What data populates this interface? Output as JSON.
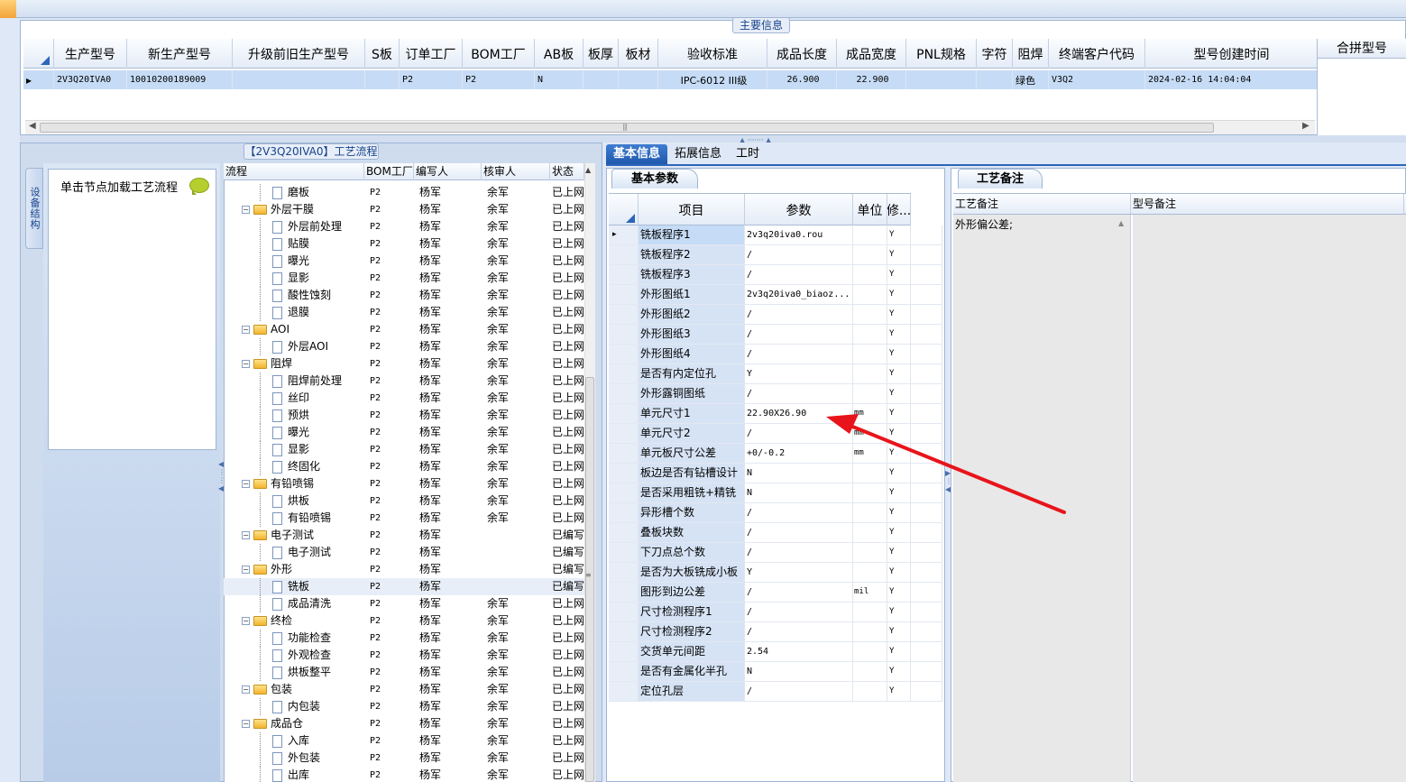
{
  "main_info": {
    "title": "主要信息",
    "columns": [
      "生产型号",
      "新生产型号",
      "升级前旧生产型号",
      "S板",
      "订单工厂",
      "BOM工厂",
      "AB板",
      "板厚",
      "板材",
      "验收标准",
      "成品长度",
      "成品宽度",
      "PNL规格",
      "字符",
      "阻焊",
      "终端客户代码",
      "型号创建时间"
    ],
    "row": [
      "2V3Q20IVA0",
      "10010200189009",
      "",
      "",
      "P2",
      "P2",
      "N",
      "",
      "",
      "IPC-6012 III级",
      "26.900",
      "22.900",
      "",
      "",
      "绿色",
      "V3Q2",
      "2024-02-16 14:04:04"
    ],
    "merge_column": "合拼型号"
  },
  "process_flow": {
    "title": "【2V3Q20IVA0】工艺流程",
    "side_tab": "设备结构",
    "nav_hint": "单击节点加载工艺流程",
    "columns": [
      "流程",
      "BOM工厂",
      "编写人",
      "核审人",
      "状态"
    ],
    "rows": [
      {
        "level": 2,
        "type": "doc",
        "name": "磨板",
        "bom": "P2",
        "writer": "杨军",
        "reviewer": "余军",
        "status": "已上网"
      },
      {
        "level": 1,
        "type": "folder",
        "name": "外层干膜",
        "bom": "P2",
        "writer": "杨军",
        "reviewer": "余军",
        "status": "已上网"
      },
      {
        "level": 2,
        "type": "doc",
        "name": "外层前处理",
        "bom": "P2",
        "writer": "杨军",
        "reviewer": "余军",
        "status": "已上网"
      },
      {
        "level": 2,
        "type": "doc",
        "name": "贴膜",
        "bom": "P2",
        "writer": "杨军",
        "reviewer": "余军",
        "status": "已上网"
      },
      {
        "level": 2,
        "type": "doc",
        "name": "曝光",
        "bom": "P2",
        "writer": "杨军",
        "reviewer": "余军",
        "status": "已上网"
      },
      {
        "level": 2,
        "type": "doc",
        "name": "显影",
        "bom": "P2",
        "writer": "杨军",
        "reviewer": "余军",
        "status": "已上网"
      },
      {
        "level": 2,
        "type": "doc",
        "name": "酸性蚀刻",
        "bom": "P2",
        "writer": "杨军",
        "reviewer": "余军",
        "status": "已上网"
      },
      {
        "level": 2,
        "type": "doc",
        "name": "退膜",
        "bom": "P2",
        "writer": "杨军",
        "reviewer": "余军",
        "status": "已上网"
      },
      {
        "level": 1,
        "type": "folder",
        "name": "AOI",
        "bom": "P2",
        "writer": "杨军",
        "reviewer": "余军",
        "status": "已上网"
      },
      {
        "level": 2,
        "type": "doc",
        "name": "外层AOI",
        "bom": "P2",
        "writer": "杨军",
        "reviewer": "余军",
        "status": "已上网"
      },
      {
        "level": 1,
        "type": "folder",
        "name": "阻焊",
        "bom": "P2",
        "writer": "杨军",
        "reviewer": "余军",
        "status": "已上网"
      },
      {
        "level": 2,
        "type": "doc",
        "name": "阻焊前处理",
        "bom": "P2",
        "writer": "杨军",
        "reviewer": "余军",
        "status": "已上网"
      },
      {
        "level": 2,
        "type": "doc",
        "name": "丝印",
        "bom": "P2",
        "writer": "杨军",
        "reviewer": "余军",
        "status": "已上网"
      },
      {
        "level": 2,
        "type": "doc",
        "name": "预烘",
        "bom": "P2",
        "writer": "杨军",
        "reviewer": "余军",
        "status": "已上网"
      },
      {
        "level": 2,
        "type": "doc",
        "name": "曝光",
        "bom": "P2",
        "writer": "杨军",
        "reviewer": "余军",
        "status": "已上网"
      },
      {
        "level": 2,
        "type": "doc",
        "name": "显影",
        "bom": "P2",
        "writer": "杨军",
        "reviewer": "余军",
        "status": "已上网"
      },
      {
        "level": 2,
        "type": "doc",
        "name": "终固化",
        "bom": "P2",
        "writer": "杨军",
        "reviewer": "余军",
        "status": "已上网"
      },
      {
        "level": 1,
        "type": "folder",
        "name": "有铅喷锡",
        "bom": "P2",
        "writer": "杨军",
        "reviewer": "余军",
        "status": "已上网"
      },
      {
        "level": 2,
        "type": "doc",
        "name": "烘板",
        "bom": "P2",
        "writer": "杨军",
        "reviewer": "余军",
        "status": "已上网"
      },
      {
        "level": 2,
        "type": "doc",
        "name": "有铅喷锡",
        "bom": "P2",
        "writer": "杨军",
        "reviewer": "余军",
        "status": "已上网"
      },
      {
        "level": 1,
        "type": "folder",
        "name": "电子测试",
        "bom": "P2",
        "writer": "杨军",
        "reviewer": "",
        "status": "已编写"
      },
      {
        "level": 2,
        "type": "doc",
        "name": "电子测试",
        "bom": "P2",
        "writer": "杨军",
        "reviewer": "",
        "status": "已编写"
      },
      {
        "level": 1,
        "type": "folder",
        "name": "外形",
        "bom": "P2",
        "writer": "杨军",
        "reviewer": "",
        "status": "已编写"
      },
      {
        "level": 2,
        "type": "doc",
        "name": "铣板",
        "bom": "P2",
        "writer": "杨军",
        "reviewer": "",
        "status": "已编写",
        "selected": true
      },
      {
        "level": 2,
        "type": "doc",
        "name": "成品清洗",
        "bom": "P2",
        "writer": "杨军",
        "reviewer": "余军",
        "status": "已上网"
      },
      {
        "level": 1,
        "type": "folder",
        "name": "终检",
        "bom": "P2",
        "writer": "杨军",
        "reviewer": "余军",
        "status": "已上网"
      },
      {
        "level": 2,
        "type": "doc",
        "name": "功能检查",
        "bom": "P2",
        "writer": "杨军",
        "reviewer": "余军",
        "status": "已上网"
      },
      {
        "level": 2,
        "type": "doc",
        "name": "外观检查",
        "bom": "P2",
        "writer": "杨军",
        "reviewer": "余军",
        "status": "已上网"
      },
      {
        "level": 2,
        "type": "doc",
        "name": "烘板整平",
        "bom": "P2",
        "writer": "杨军",
        "reviewer": "余军",
        "status": "已上网"
      },
      {
        "level": 1,
        "type": "folder",
        "name": "包装",
        "bom": "P2",
        "writer": "杨军",
        "reviewer": "余军",
        "status": "已上网"
      },
      {
        "level": 2,
        "type": "doc",
        "name": "内包装",
        "bom": "P2",
        "writer": "杨军",
        "reviewer": "余军",
        "status": "已上网"
      },
      {
        "level": 1,
        "type": "folder",
        "name": "成品仓",
        "bom": "P2",
        "writer": "杨军",
        "reviewer": "余军",
        "status": "已上网"
      },
      {
        "level": 2,
        "type": "doc",
        "name": "入库",
        "bom": "P2",
        "writer": "杨军",
        "reviewer": "余军",
        "status": "已上网"
      },
      {
        "level": 2,
        "type": "doc",
        "name": "外包装",
        "bom": "P2",
        "writer": "杨军",
        "reviewer": "余军",
        "status": "已上网"
      },
      {
        "level": 2,
        "type": "doc",
        "name": "出库",
        "bom": "P2",
        "writer": "杨军",
        "reviewer": "余军",
        "status": "已上网"
      }
    ]
  },
  "tabs": [
    "基本信息",
    "拓展信息",
    "工时"
  ],
  "basic_params": {
    "title": "基本参数",
    "columns": [
      "项目",
      "参数",
      "单位",
      "修..."
    ],
    "rows": [
      [
        "铣板程序1",
        "2v3q20iva0.rou",
        "",
        "Y"
      ],
      [
        "铣板程序2",
        "/",
        "",
        "Y"
      ],
      [
        "铣板程序3",
        "/",
        "",
        "Y"
      ],
      [
        "外形图纸1",
        "2v3q20iva0_biaoz...",
        "",
        "Y"
      ],
      [
        "外形图纸2",
        "/",
        "",
        "Y"
      ],
      [
        "外形图纸3",
        "/",
        "",
        "Y"
      ],
      [
        "外形图纸4",
        "/",
        "",
        "Y"
      ],
      [
        "是否有内定位孔",
        "Y",
        "",
        "Y"
      ],
      [
        "外形露铜图纸",
        "/",
        "",
        "Y"
      ],
      [
        "单元尺寸1",
        "22.90X26.90",
        "mm",
        "Y"
      ],
      [
        "单元尺寸2",
        "/",
        "mm",
        "Y"
      ],
      [
        "单元板尺寸公差",
        "+0/-0.2",
        "mm",
        "Y"
      ],
      [
        "板边是否有钻槽设计",
        "N",
        "",
        "Y"
      ],
      [
        "是否采用粗铣+精铣",
        "N",
        "",
        "Y"
      ],
      [
        "异形槽个数",
        "/",
        "",
        "Y"
      ],
      [
        "叠板块数",
        "/",
        "",
        "Y"
      ],
      [
        "下刀点总个数",
        "/",
        "",
        "Y"
      ],
      [
        "是否为大板铣成小板",
        "Y",
        "",
        "Y"
      ],
      [
        "图形到边公差",
        "/",
        "mil",
        "Y"
      ],
      [
        "尺寸检测程序1",
        "/",
        "",
        "Y"
      ],
      [
        "尺寸检测程序2",
        "/",
        "",
        "Y"
      ],
      [
        "交货单元间距",
        "2.54",
        "",
        "Y"
      ],
      [
        "是否有金属化半孔",
        "N",
        "",
        "Y"
      ],
      [
        "定位孔层",
        "/",
        "",
        "Y"
      ]
    ]
  },
  "process_notes": {
    "title": "工艺备注",
    "columns": [
      "工艺备注",
      "型号备注"
    ],
    "note_text": "外形偏公差;"
  },
  "colors": {
    "accent": "#1f59ad",
    "selection": "#c6dcf6",
    "annotation_arrow": "#e8141b"
  }
}
